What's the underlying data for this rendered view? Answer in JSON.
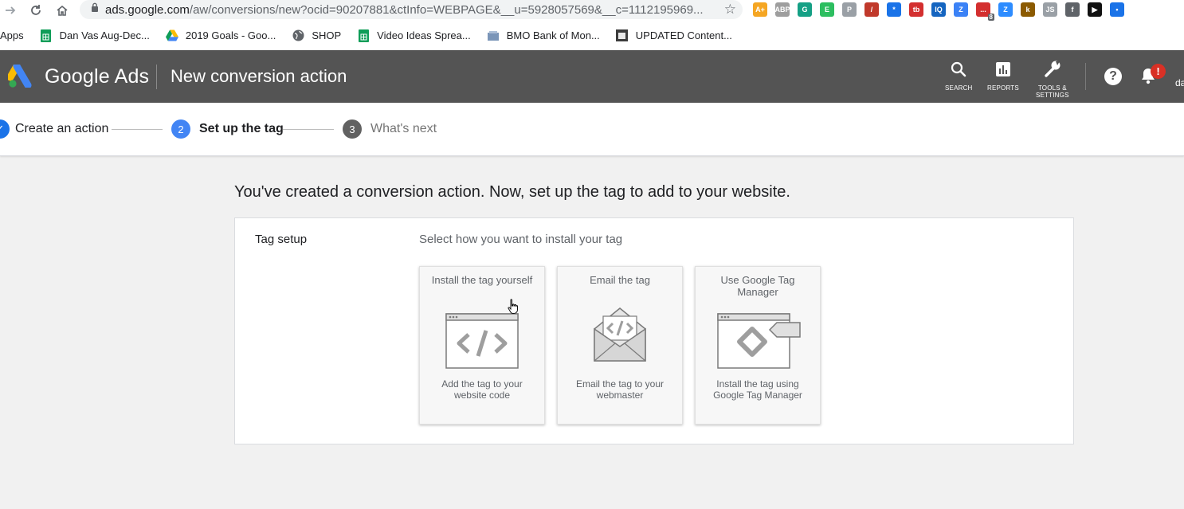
{
  "browser": {
    "url_host": "ads.google.com",
    "url_path": "/aw/conversions/new?ocid=90207881&ctInfo=WEBPAGE&__u=5928057569&__c=1112195969...",
    "extensions": [
      {
        "name": "scout-ext",
        "color": "#f5a623",
        "text": "A+"
      },
      {
        "name": "adblock-ext",
        "color": "#9e9e9e",
        "text": "ABP"
      },
      {
        "name": "grammarly-ext",
        "color": "#15a085",
        "text": "G"
      },
      {
        "name": "evernote-ext",
        "color": "#2dbe60",
        "text": "E"
      },
      {
        "name": "photo-ext",
        "color": "#9aa0a6",
        "text": "P"
      },
      {
        "name": "paint-ext",
        "color": "#c0392b",
        "text": "/"
      },
      {
        "name": "network-ext",
        "color": "#1a73e8",
        "text": "*"
      },
      {
        "name": "tubebuddy-ext",
        "color": "#d32f2f",
        "text": "tb"
      },
      {
        "name": "iq-ext",
        "color": "#1565c0",
        "text": "IQ"
      },
      {
        "name": "z-ext",
        "color": "#3b82f6",
        "text": "Z"
      },
      {
        "name": "todo-ext",
        "color": "#d32f2f",
        "text": "..."
      },
      {
        "name": "zoom-ext",
        "color": "#2d8cff",
        "text": "Z"
      },
      {
        "name": "k-ext",
        "color": "#8b5a00",
        "text": "k"
      },
      {
        "name": "js-ext",
        "color": "#9aa0a6",
        "text": "JS"
      },
      {
        "name": "circle-ext",
        "color": "#5f6368",
        "text": "f"
      },
      {
        "name": "play-ext",
        "color": "#111111",
        "text": "▶"
      },
      {
        "name": "person-ext",
        "color": "#1a73e8",
        "text": "•"
      }
    ],
    "todo_badge": "8"
  },
  "bookmarks": {
    "apps_label": "Apps",
    "items": [
      {
        "label": "Dan Vas Aug-Dec..."
      },
      {
        "label": "2019 Goals - Goo..."
      },
      {
        "label": "SHOP"
      },
      {
        "label": "Video Ideas Sprea..."
      },
      {
        "label": "BMO Bank of Mon..."
      },
      {
        "label": "UPDATED Content..."
      }
    ]
  },
  "header": {
    "brand": "Google Ads",
    "page_title": "New conversion action",
    "search_label": "SEARCH",
    "reports_label": "REPORTS",
    "tools_label_1": "TOOLS &",
    "tools_label_2": "SETTINGS",
    "help_glyph": "?",
    "alert_glyph": "!",
    "account_text": "da"
  },
  "stepper": {
    "steps": [
      {
        "number": "✓",
        "label": "Create an action",
        "state": "done"
      },
      {
        "number": "2",
        "label": "Set up the tag",
        "state": "active"
      },
      {
        "number": "3",
        "label": "What's next",
        "state": "pending"
      }
    ],
    "colors": {
      "done": "#1a73e8",
      "active": "#4285f4",
      "pending": "#616161"
    }
  },
  "content": {
    "headline": "You've created a conversion action. Now, set up the tag to add to your website.",
    "panel_label": "Tag setup",
    "panel_hint": "Select how you want to install your tag",
    "options": [
      {
        "title": "Install the tag yourself",
        "description": "Add the tag to your website code",
        "icon": "browser-code-icon"
      },
      {
        "title": "Email the tag",
        "description": "Email the tag to your webmaster",
        "icon": "envelope-code-icon"
      },
      {
        "title": "Use Google Tag Manager",
        "description": "Install the tag using Google Tag Manager",
        "icon": "tag-manager-icon"
      }
    ]
  }
}
